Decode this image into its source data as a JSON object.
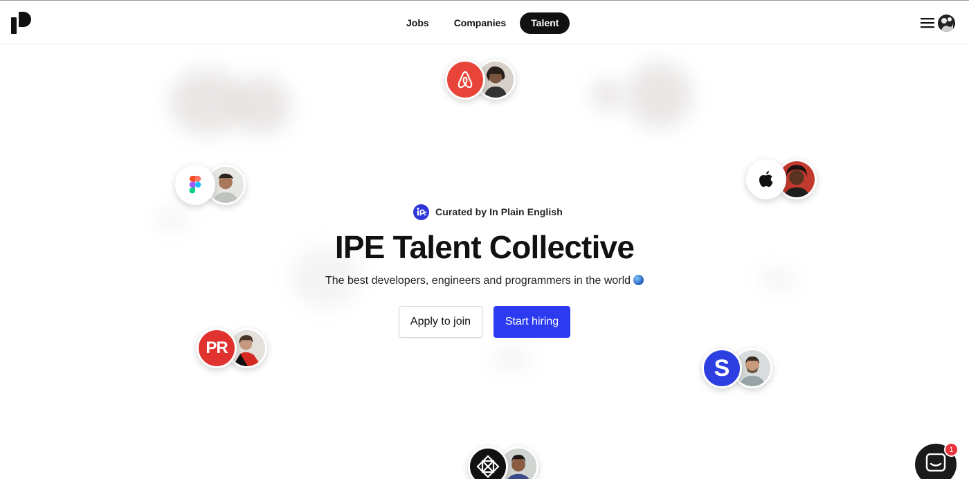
{
  "nav": {
    "items": [
      {
        "label": "Jobs",
        "active": false
      },
      {
        "label": "Companies",
        "active": false
      },
      {
        "label": "Talent",
        "active": true
      }
    ]
  },
  "hero": {
    "curated_label": "Curated by In Plain English",
    "title": "IPE Talent Collective",
    "subtitle": "The best developers, engineers and programmers in the world",
    "apply_label": "Apply to join",
    "hire_label": "Start hiring"
  },
  "companies": {
    "pr_logo_text": "PR",
    "s_logo_text": "S"
  },
  "chat": {
    "badge_count": "1"
  },
  "colors": {
    "accent": "#2c3bf0",
    "airbnb": "#e8443a",
    "pr": "#e0322e",
    "stripe_like": "#2d3fe0"
  }
}
